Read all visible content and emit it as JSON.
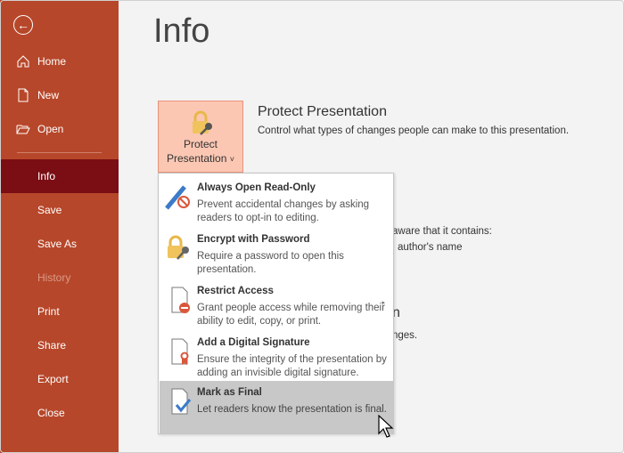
{
  "sidebar": {
    "back_icon": "back-arrow-icon",
    "items": [
      {
        "label": "Home",
        "icon": "home-icon"
      },
      {
        "label": "New",
        "icon": "new-document-icon"
      },
      {
        "label": "Open",
        "icon": "folder-icon"
      },
      {
        "label": "Info",
        "active": true
      },
      {
        "label": "Save"
      },
      {
        "label": "Save As"
      },
      {
        "label": "History",
        "disabled": true
      },
      {
        "label": "Print"
      },
      {
        "label": "Share"
      },
      {
        "label": "Export"
      },
      {
        "label": "Close"
      }
    ],
    "color": "#b7472a",
    "active_color": "#7a0e14"
  },
  "main": {
    "title": "Info",
    "protect": {
      "button_line1": "Protect",
      "button_line2": "Presentation",
      "chevron": "˅",
      "heading": "Protect Presentation",
      "description": "Control what types of changes people can make to this presentation."
    },
    "occluded_fragments": [
      "aware that it contains:",
      "author's name",
      "n",
      "nges."
    ]
  },
  "menu": {
    "items": [
      {
        "title": "Always Open Read-Only",
        "description": "Prevent accidental changes by asking readers to opt-in to editing.",
        "icon": "pencil-no-icon"
      },
      {
        "title": "Encrypt with Password",
        "description": "Require a password to open this presentation.",
        "icon": "lock-key-icon"
      },
      {
        "title": "Restrict Access",
        "description": "Grant people access while removing their ability to edit, copy, or print.",
        "icon": "document-restrict-icon",
        "submenu": "▸"
      },
      {
        "title": "Add a Digital Signature",
        "description": "Ensure the integrity of the presentation by adding an invisible digital signature.",
        "icon": "document-ribbon-icon"
      },
      {
        "title": "Mark as Final",
        "description": "Let readers know the presentation is final.",
        "icon": "document-check-icon",
        "highlighted": true
      }
    ]
  }
}
